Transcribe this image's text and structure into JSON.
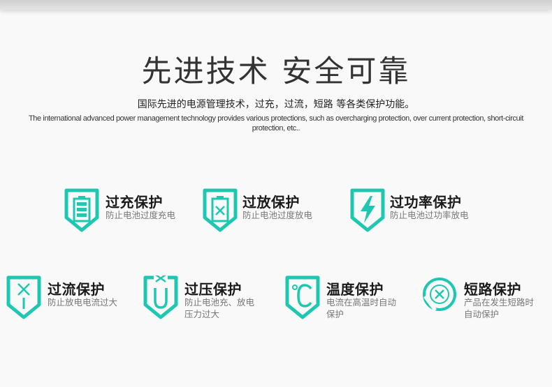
{
  "header": {
    "headline": "先进技术 安全可靠",
    "subtitle_cn": "国际先进的电源管理技术，过充，过流，短路 等各类保护功能。",
    "subtitle_en": "The international advanced power management technology provides various protections, such as overcharging protection, over current protection, short-circuit protection, etc.."
  },
  "colors": {
    "accent": "#1ec8b0",
    "text": "#222222",
    "muted": "#777777"
  },
  "features": [
    {
      "icon": "battery-full-icon",
      "title": "过充保护",
      "desc": "防止电池过度充电"
    },
    {
      "icon": "battery-x-icon",
      "title": "过放保护",
      "desc": "防止电池过度放电"
    },
    {
      "icon": "lightning-icon",
      "title": "过功率保护",
      "desc": "防止电池过功率放电"
    },
    {
      "icon": "current-icon",
      "title": "过流保护",
      "desc": "防止放电电流过大"
    },
    {
      "icon": "voltage-u-icon",
      "title": "过压保护",
      "desc": "防止电池充、放电压力过大"
    },
    {
      "icon": "celsius-icon",
      "title": "温度保护",
      "desc": "电流在高温时自动保护"
    },
    {
      "icon": "short-circuit-x-icon",
      "title": "短路保护",
      "desc": "产品在发生短路时自动保护"
    }
  ]
}
